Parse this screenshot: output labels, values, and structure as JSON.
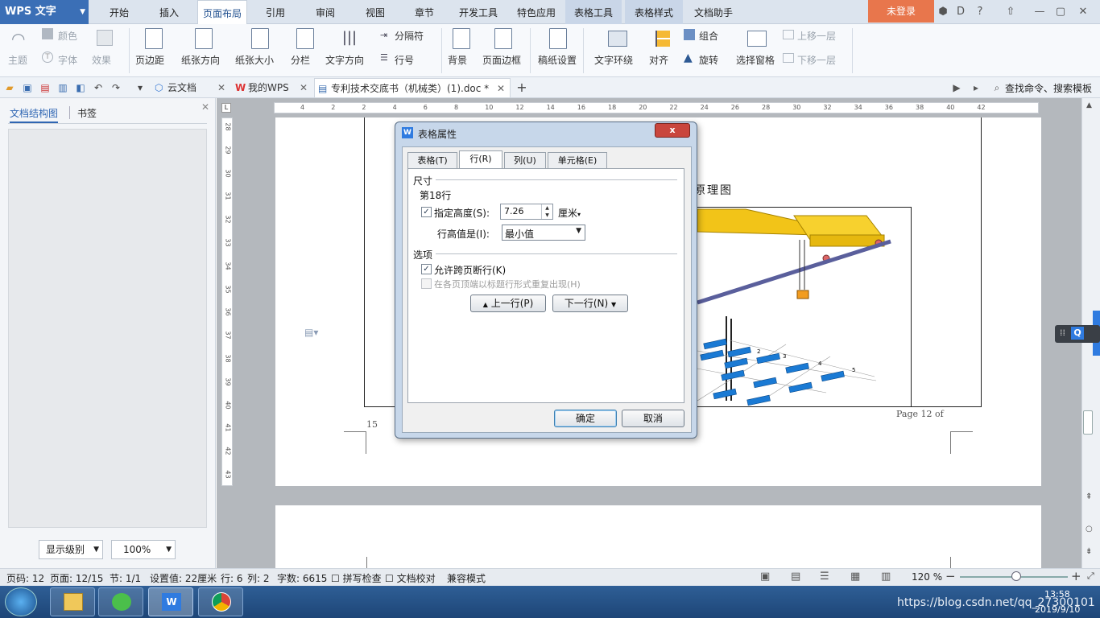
{
  "app": {
    "title": "WPS 文字"
  },
  "menu": {
    "tabs": [
      "开始",
      "插入",
      "页面布局",
      "引用",
      "审阅",
      "视图",
      "章节",
      "开发工具",
      "特色应用",
      "表格工具",
      "表格样式",
      "文档助手"
    ],
    "login": "未登录",
    "help": "?"
  },
  "ribbon": {
    "theme": "主题",
    "color": "颜色",
    "font": "字体",
    "effect": "效果",
    "margins": "页边距",
    "orientation": "纸张方向",
    "size": "纸张大小",
    "columns": "分栏",
    "text_direction": "文字方向",
    "separator": "分隔符",
    "line_number": "行号",
    "background": "背景",
    "page_border": "页面边框",
    "paper_settings": "稿纸设置",
    "wrap": "文字环绕",
    "align": "对齐",
    "group": "组合",
    "rotate": "旋转",
    "selection_pane": "选择窗格",
    "bring_forward": "上移一层",
    "send_backward": "下移一层"
  },
  "doctabs": {
    "cloud": "云文档",
    "mywps": "我的WPS",
    "doc": "专利技术交底书（机械类）(1).doc *",
    "search": "查找命令、搜索模板"
  },
  "leftpane": {
    "tab_outline": "文档结构图",
    "tab_bookmark": "书签",
    "level_select": "显示级别",
    "zoom_select": "100%"
  },
  "ruler": {
    "h": [
      "4",
      "2",
      "2",
      "4",
      "6",
      "8",
      "10",
      "12",
      "14",
      "16",
      "18",
      "20",
      "22",
      "24",
      "26",
      "28",
      "30",
      "32",
      "34",
      "36",
      "38",
      "40",
      "42"
    ],
    "v": [
      "28",
      "29",
      "30",
      "31",
      "32",
      "33",
      "34",
      "35",
      "36",
      "37",
      "38",
      "39",
      "40",
      "41",
      "42",
      "43"
    ]
  },
  "page": {
    "heading_fragment": "原理图",
    "page_num": "15",
    "footer": "Page 12 of",
    "figure_labels": [
      "2",
      "3",
      "4",
      "5"
    ]
  },
  "dialog": {
    "title": "表格属性",
    "close": "x",
    "tabs": [
      "表格(T)",
      "行(R)",
      "列(U)",
      "单元格(E)"
    ],
    "size_section": "尺寸",
    "row_label": "第18行",
    "specify_height": "指定高度(S):",
    "height_value": "7.26",
    "unit": "厘米",
    "row_height_is": "行高值是(I):",
    "row_height_mode": "最小值",
    "options_section": "选项",
    "allow_break": "允许跨页断行(K)",
    "repeat_header": "在各页顶端以标题行形式重复出现(H)",
    "prev_row": "上一行(P)",
    "next_row": "下一行(N)",
    "ok": "确定",
    "cancel": "取消"
  },
  "status": {
    "page_code": "页码: 12",
    "page": "页面: 12/15",
    "section": "节: 1/1",
    "setting": "设置值: 22厘米",
    "row": "行: 6",
    "col": "列: 2",
    "words": "字数: 6615",
    "spell": "拼写检查",
    "proof": "文档校对",
    "compat": "兼容模式",
    "zoom": "120 %"
  },
  "taskbar": {
    "watermark": "https://blog.csdn.net/qq_27300101",
    "time": "13:58",
    "date": "2019/9/10"
  },
  "colors": {
    "accent": "#3b6fb6",
    "login": "#e8764c",
    "taskbar": "#1d4577",
    "close": "#c9463d"
  }
}
